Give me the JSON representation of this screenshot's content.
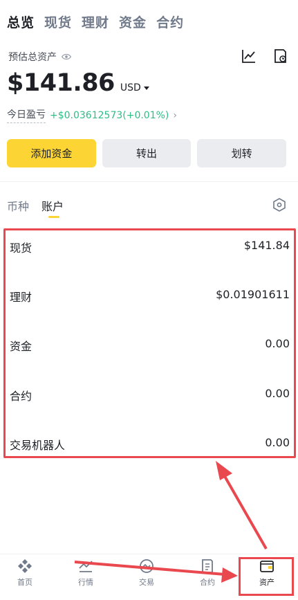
{
  "top_tabs": [
    "总览",
    "现货",
    "理财",
    "资金",
    "合约"
  ],
  "estimate_label": "预估总资产",
  "balance": "$141.86",
  "currency": "USD",
  "pnl_label": "今日盈亏",
  "pnl_value": "+$0.03612573(+0.01%)",
  "actions": {
    "deposit": "添加资金",
    "withdraw": "转出",
    "transfer": "划转"
  },
  "sub_tabs": [
    "币种",
    "账户"
  ],
  "accounts": [
    {
      "name": "现货",
      "value": "$141.84"
    },
    {
      "name": "理财",
      "value": "$0.01901611"
    },
    {
      "name": "资金",
      "value": "0.00"
    },
    {
      "name": "合约",
      "value": "0.00"
    },
    {
      "name": "交易机器人",
      "value": "0.00"
    }
  ],
  "bottom_nav": [
    "首页",
    "行情",
    "交易",
    "合约",
    "资产"
  ],
  "colors": {
    "accent": "#fcd535",
    "positive": "#2ebd85",
    "annotation": "#e9484f"
  }
}
